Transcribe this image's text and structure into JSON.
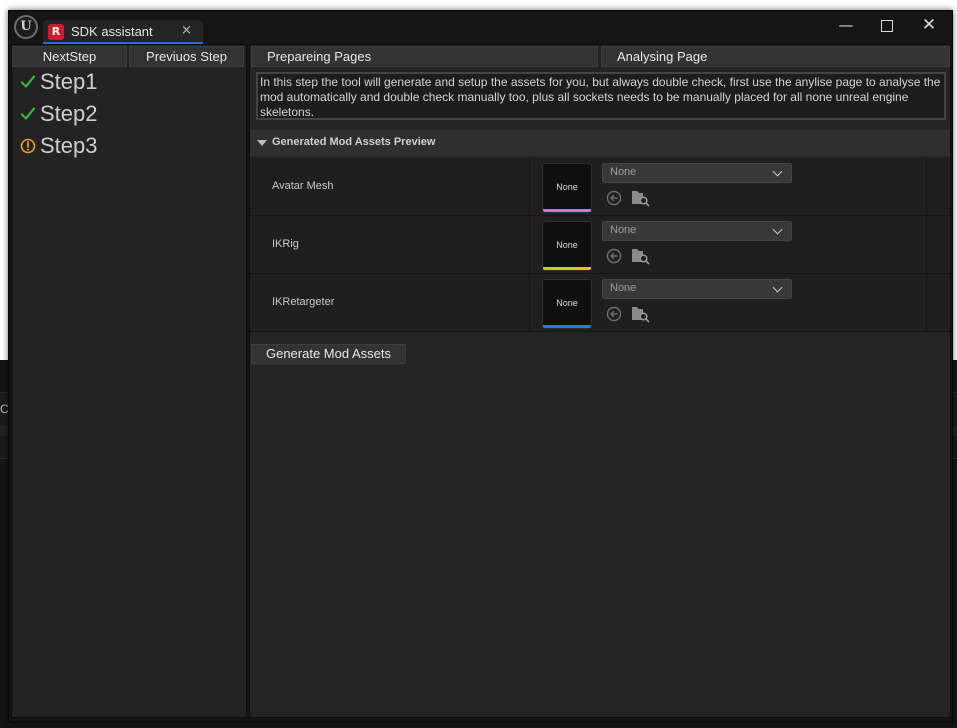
{
  "window": {
    "tab_title": "SDK assistant",
    "tab_close": "×",
    "logo_glyph": "U",
    "app_icon_glyph": "R",
    "minimize_glyph": "—",
    "close_glyph": "✕"
  },
  "background": {
    "fragment_text": "C"
  },
  "left_panel": {
    "next_button": "NextStep",
    "prev_button": "Previuos Step",
    "steps": [
      {
        "label": "Step1",
        "status": "done",
        "icon": "checkmark-icon",
        "color": "#2ec02e"
      },
      {
        "label": "Step2",
        "status": "done",
        "icon": "checkmark-icon",
        "color": "#2ec02e"
      },
      {
        "label": "Step3",
        "status": "warning",
        "icon": "warning-circle-icon",
        "color": "#e6a01c"
      }
    ]
  },
  "right_panel": {
    "tabs": [
      "Prepareing Pages",
      "Analysing Page"
    ],
    "info_text": "In this step the tool will generate and setup the assets for you, but always double check, first use the anylise page to analyse the mod automatically and double check manually too, plus all sockets needs to be manually placed for all none unreal engine skeletons.",
    "section_title": "Generated Mod Assets Preview",
    "properties": [
      {
        "label": "Avatar Mesh",
        "thumbnail": "None",
        "value": "None",
        "accent": "#d86fd6"
      },
      {
        "label": "IKRig",
        "thumbnail": "None",
        "value": "None",
        "accent": "#e8c21c"
      },
      {
        "label": "IKRetargeter",
        "thumbnail": "None",
        "value": "None",
        "accent": "#2f77d8"
      }
    ],
    "generate_button": "Generate Mod Assets"
  },
  "colors": {
    "window_bg": "#151515",
    "panel_bg": "#242424",
    "tab_accent": "#2e6ad6",
    "app_icon": "#d11a2a"
  }
}
